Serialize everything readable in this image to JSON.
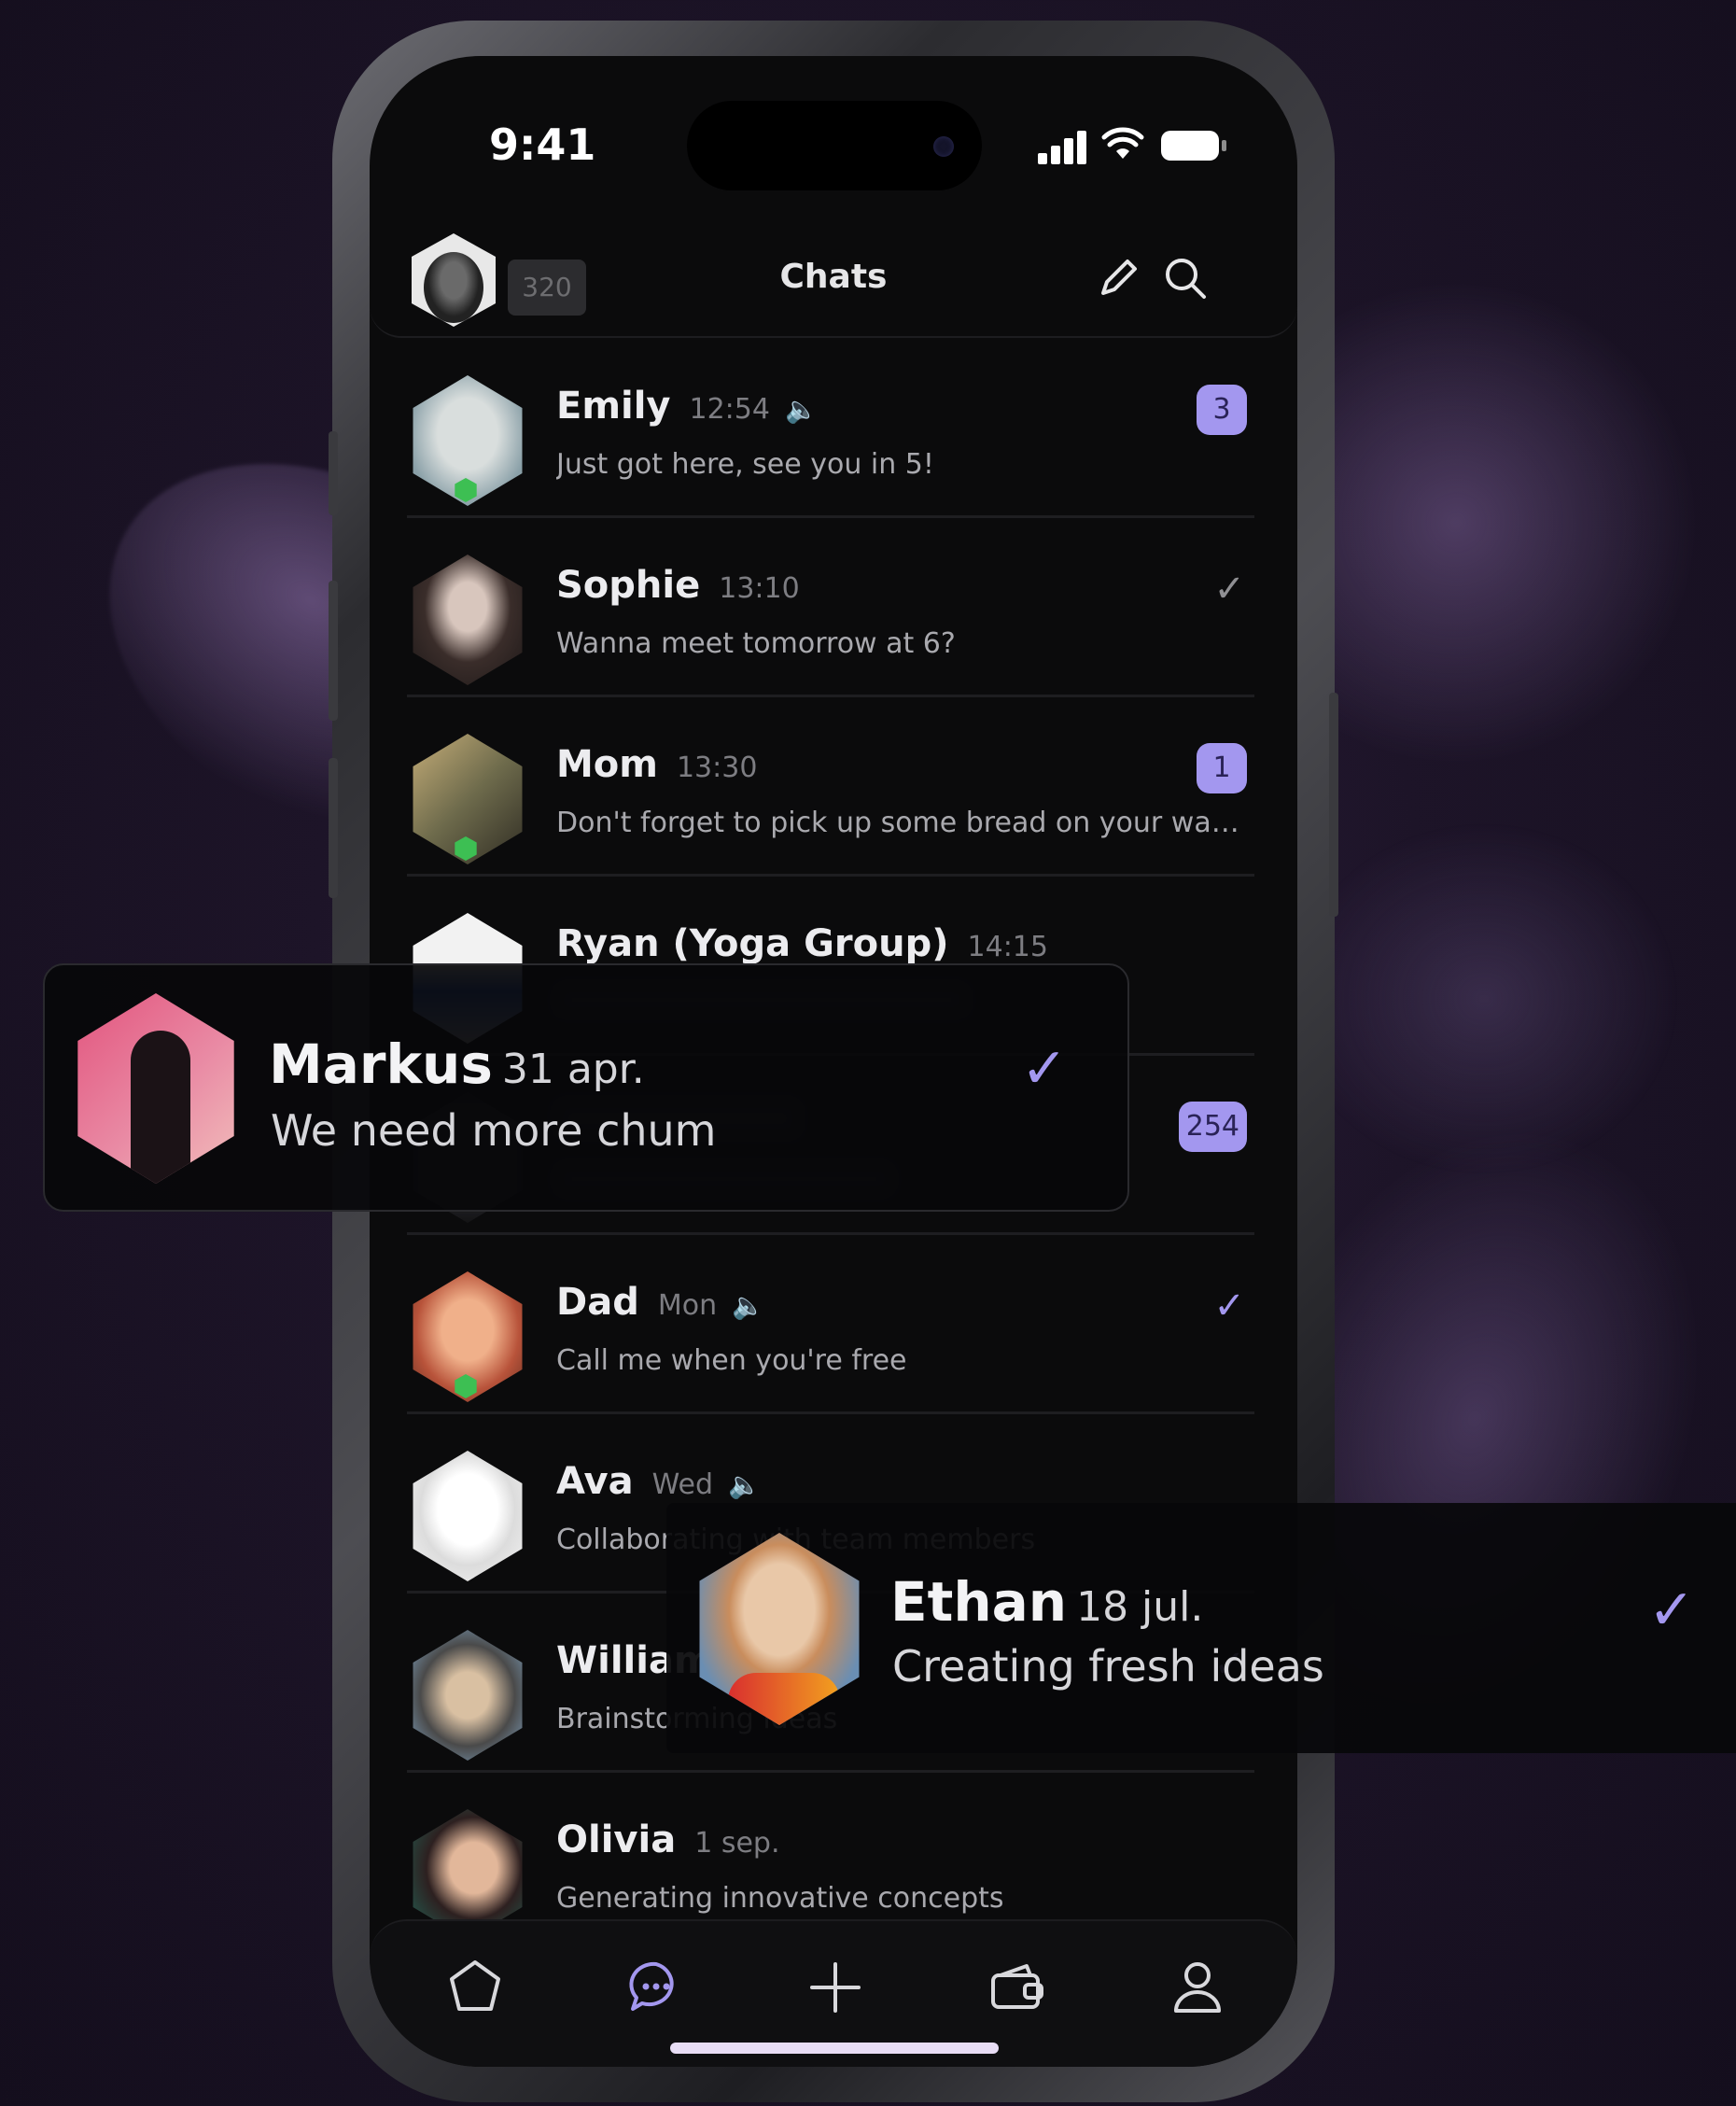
{
  "status_bar": {
    "time": "9:41"
  },
  "header": {
    "title": "Chats",
    "count_badge": "320"
  },
  "chats": [
    {
      "name": "Emily",
      "time": "12:54",
      "message": "Just got here, see you in 5!",
      "unread": "3",
      "muted": true,
      "online": true
    },
    {
      "name": "Sophie",
      "time": "13:10",
      "message": "Wanna meet tomorrow at 6?",
      "read": true
    },
    {
      "name": "Mom",
      "time": "13:30",
      "message": "Don't forget to pick up some bread on your way ho...",
      "unread": "1",
      "online": true
    },
    {
      "name": "Ryan (Yoga Group)",
      "time": "14:15",
      "message": ""
    },
    {
      "name": "",
      "time": "",
      "message": "",
      "unread": "254"
    },
    {
      "name": "Dad",
      "time": "Mon",
      "message": "Call me when you're free",
      "muted": true,
      "online": true,
      "read": true
    },
    {
      "name": "Ava",
      "time": "Wed",
      "message": "Collaborating with team members",
      "muted": true
    },
    {
      "name": "William",
      "time": "",
      "message": "Brainstorming ideas",
      "read": true
    },
    {
      "name": "Olivia",
      "time": "1 sep.",
      "message": "Generating innovative concepts"
    }
  ],
  "floating": {
    "markus": {
      "name": "Markus",
      "date": "31 apr.",
      "message": "We need more chum"
    },
    "ethan": {
      "name": "Ethan",
      "date": "18 jul.",
      "message": "Creating fresh ideas"
    }
  },
  "nav": [
    "home-icon",
    "chat-icon",
    "plus-icon",
    "wallet-icon",
    "profile-icon"
  ],
  "colors": {
    "accent": "#a397ef",
    "online": "#3dbf53",
    "background": "#0b0b0c"
  }
}
